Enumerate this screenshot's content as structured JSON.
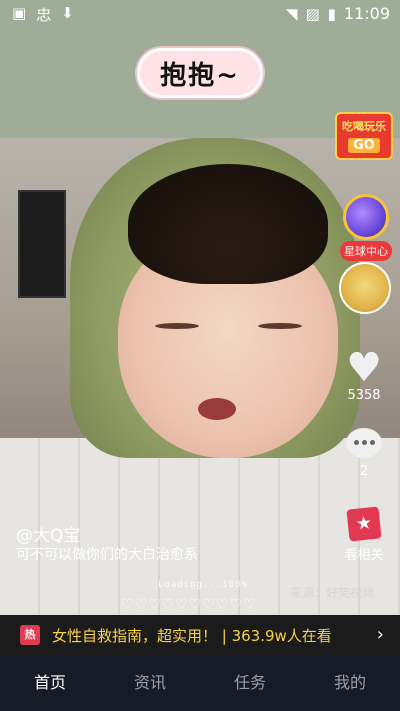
{
  "status_bar": {
    "left_icons": [
      "忠",
      "⬇"
    ],
    "time": "11:09"
  },
  "sticker": {
    "text": "抱抱~"
  },
  "promo": {
    "title": "吃喝玩乐",
    "go": "GO"
  },
  "planet": {
    "label": "星球中心"
  },
  "likes": {
    "count": "5358"
  },
  "comments": {
    "count": "2"
  },
  "related": {
    "label": "看相关"
  },
  "author": {
    "handle": "@大Q宝"
  },
  "caption": {
    "text": "可不可以做你们的大白治愈系"
  },
  "loading": {
    "text": "Loading...100%"
  },
  "hearts_row": {
    "text": "♡♡♡♡♡♡♡♡♡♡"
  },
  "source": {
    "text": "来源：好笑视频"
  },
  "hot_bar": {
    "badge": "热",
    "text": "女性自救指南，超实用！ | 363.9w人在看",
    "arrow": "›"
  },
  "bottom_nav": {
    "items": [
      {
        "label": "首页"
      },
      {
        "label": "资讯"
      },
      {
        "label": "任务"
      },
      {
        "label": "我的"
      }
    ]
  }
}
